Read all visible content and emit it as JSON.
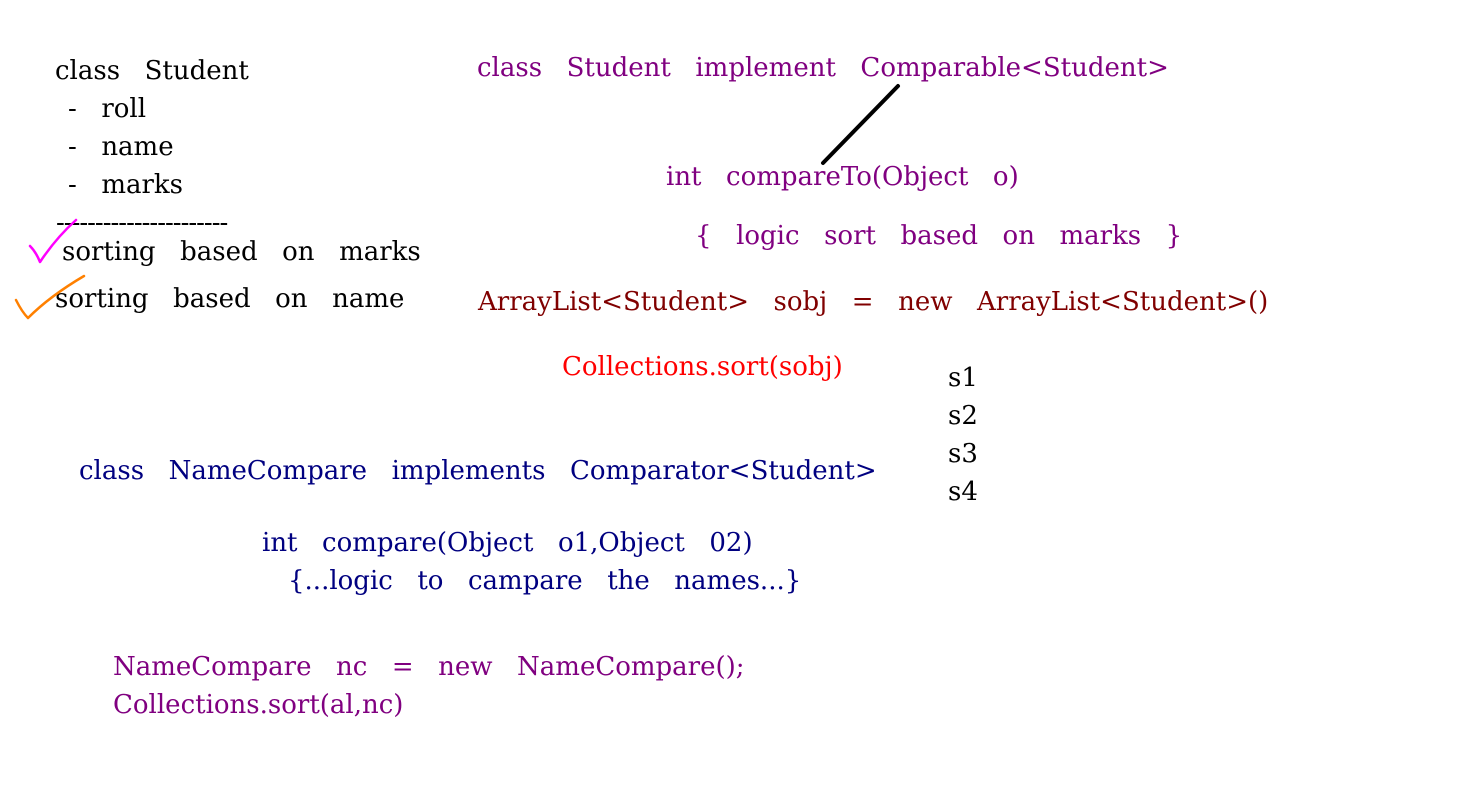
{
  "colors": {
    "text": "#000000",
    "comparable_code": "#800080",
    "arraylist_code": "#800000",
    "sort_call": "#ff0000",
    "comparator_code": "#000080",
    "namecompare_code": "#800080",
    "pen_black": "#000000",
    "pen_magenta": "#ff00ff",
    "pen_orange": "#ff8000"
  },
  "student_class": {
    "title": "class  Student",
    "fields": [
      "-  roll",
      "-  name",
      "-  marks"
    ],
    "divider": "----------------------",
    "options": [
      "sorting  based  on  marks",
      "sorting  based  on  name"
    ]
  },
  "comparable": {
    "declaration": "class  Student  implement  Comparable<Student>",
    "method": "int  compareTo(Object  o)",
    "body": "{  logic  sort  based  on  marks  }",
    "list_decl": "ArrayList<Student>  sobj  =  new  ArrayList<Student>()",
    "sort_call": "Collections.sort(sobj)"
  },
  "sorted_list": [
    "s1",
    "s2",
    "s3",
    "s4"
  ],
  "comparator": {
    "declaration": "class  NameCompare  implements  Comparator<Student>",
    "method": "int  compare(Object  o1,Object  02)",
    "body": "{...logic  to  campare  the  names...}",
    "instance": "NameCompare  nc  =  new  NameCompare();",
    "sort_call": "Collections.sort(al,nc)"
  },
  "annotations": {
    "checkmarks": [
      "magenta-check",
      "orange-check"
    ],
    "pointer_line": "black-line"
  }
}
